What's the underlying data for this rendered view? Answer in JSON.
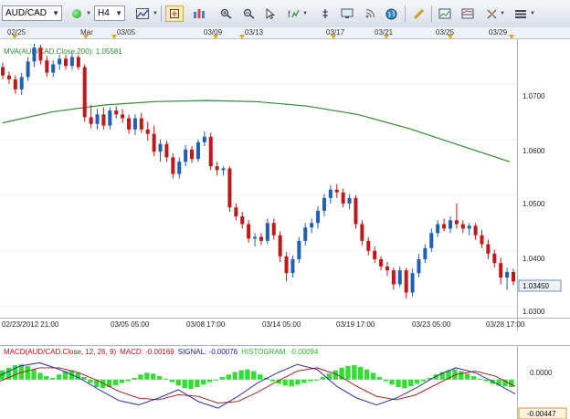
{
  "toolbar": {
    "symbol": "AUD/CAD",
    "timeframe": "H4",
    "icons": [
      "chart-type-icon",
      "crosshair-icon",
      "zoom-in-icon",
      "zoom-out-icon",
      "cursor-icon",
      "magnifier-icon",
      "indicators-icon",
      "properties-icon",
      "rss-icon",
      "globe-icon",
      "ruler-icon",
      "screenshot-icon",
      "template-icon",
      "drawing-tools-icon",
      "menu-icon"
    ]
  },
  "timeline": {
    "labels": [
      "02/25",
      "Mar",
      "03/05",
      "03/09",
      "03/13",
      "03/17",
      "03/21",
      "03/25",
      "03/29"
    ]
  },
  "price_panel": {
    "indicator_label": "MVA(AUD/CAD.Close,200): 1.05581",
    "current_price": "1.03450",
    "y_labels": [
      "1.0700",
      "1.0600",
      "1.0500",
      "1.0400",
      "1.0300"
    ],
    "x_labels": [
      "02/23/2012 21:00",
      "03/05 05:00",
      "03/08 17:00",
      "03/14 05:00",
      "03/19 17:00",
      "03/23 05:00",
      "03/28 17:00"
    ]
  },
  "macd_panel": {
    "label_macd": "MACD(AUD/CAD.Close, 12, 26, 9)",
    "label_value": "MACD: -0.00169",
    "label_signal": "SIGNAL: -0.00076",
    "label_histogram": "HISTOGRAM: -0.00094",
    "y_labels": [
      "0.0000",
      "-0.00447"
    ]
  },
  "colors": {
    "up": "#1f5fb4",
    "down": "#c01818",
    "mva": "#2e8b2e",
    "hist": "#33dd33",
    "macd": "#1a1aa8",
    "signal": "#a01010"
  },
  "chart_data": [
    {
      "type": "candlestick",
      "title": "AUD/CAD H4",
      "ylim": [
        1.028,
        1.078
      ],
      "series": [
        {
          "name": "AUD/CAD",
          "values": [
            [
              1.073,
              1.0738,
              1.0708,
              1.0715
            ],
            [
              1.0715,
              1.0722,
              1.07,
              1.0708
            ],
            [
              1.0708,
              1.0715,
              1.0682,
              1.069
            ],
            [
              1.069,
              1.072,
              1.068,
              1.0712
            ],
            [
              1.0712,
              1.0748,
              1.0705,
              1.074
            ],
            [
              1.074,
              1.0772,
              1.073,
              1.0765
            ],
            [
              1.0765,
              1.077,
              1.0735,
              1.0742
            ],
            [
              1.0742,
              1.075,
              1.0712,
              1.072
            ],
            [
              1.072,
              1.0742,
              1.0712,
              1.0735
            ],
            [
              1.0735,
              1.0752,
              1.0725,
              1.0745
            ],
            [
              1.0745,
              1.0752,
              1.0725,
              1.0732
            ],
            [
              1.0732,
              1.0755,
              1.0725,
              1.0748
            ],
            [
              1.0748,
              1.0752,
              1.0725,
              1.073
            ],
            [
              1.073,
              1.0735,
              1.0632,
              1.064
            ],
            [
              1.064,
              1.0662,
              1.062,
              1.0628
            ],
            [
              1.0628,
              1.0655,
              1.0618,
              1.0645
            ],
            [
              1.0645,
              1.0658,
              1.0618,
              1.0625
            ],
            [
              1.0625,
              1.0658,
              1.0618,
              1.0652
            ],
            [
              1.0652,
              1.066,
              1.0638,
              1.0645
            ],
            [
              1.0645,
              1.0655,
              1.063,
              1.0638
            ],
            [
              1.0638,
              1.0645,
              1.061,
              1.0618
            ],
            [
              1.0618,
              1.0645,
              1.0608,
              1.0638
            ],
            [
              1.0638,
              1.0648,
              1.0612,
              1.0618
            ],
            [
              1.0618,
              1.0632,
              1.0598,
              1.061
            ],
            [
              1.061,
              1.0625,
              1.057,
              1.0578
            ],
            [
              1.0578,
              1.06,
              1.056,
              1.0592
            ],
            [
              1.0592,
              1.0598,
              1.056,
              1.0568
            ],
            [
              1.0568,
              1.0575,
              1.053,
              1.0538
            ],
            [
              1.0538,
              1.0568,
              1.053,
              1.056
            ],
            [
              1.056,
              1.059,
              1.0552,
              1.0582
            ],
            [
              1.0582,
              1.0588,
              1.0558,
              1.0565
            ],
            [
              1.0565,
              1.06,
              1.056,
              1.0595
            ],
            [
              1.0595,
              1.0615,
              1.0588,
              1.0605
            ],
            [
              1.0605,
              1.0612,
              1.0545,
              1.0552
            ],
            [
              1.0552,
              1.056,
              1.0535,
              1.0545
            ],
            [
              1.0545,
              1.0552,
              1.0535,
              1.0548
            ],
            [
              1.0548,
              1.0552,
              1.047,
              1.0478
            ],
            [
              1.0478,
              1.0485,
              1.0455,
              1.0462
            ],
            [
              1.0462,
              1.047,
              1.044,
              1.0448
            ],
            [
              1.0448,
              1.0455,
              1.0415,
              1.0422
            ],
            [
              1.0422,
              1.0432,
              1.0408,
              1.0425
            ],
            [
              1.0425,
              1.0432,
              1.041,
              1.0418
            ],
            [
              1.0418,
              1.0458,
              1.0412,
              1.045
            ],
            [
              1.045,
              1.0458,
              1.042,
              1.0428
            ],
            [
              1.0428,
              1.0435,
              1.038,
              1.039
            ],
            [
              1.039,
              1.0398,
              1.0345,
              1.036
            ],
            [
              1.036,
              1.0392,
              1.0352,
              1.0385
            ],
            [
              1.0385,
              1.0425,
              1.0378,
              1.0418
            ],
            [
              1.0418,
              1.045,
              1.041,
              1.0442
            ],
            [
              1.0442,
              1.0458,
              1.0432,
              1.045
            ],
            [
              1.045,
              1.048,
              1.044,
              1.0472
            ],
            [
              1.0472,
              1.0502,
              1.0462,
              1.0495
            ],
            [
              1.0495,
              1.0518,
              1.0485,
              1.051
            ],
            [
              1.051,
              1.052,
              1.0495,
              1.0505
            ],
            [
              1.0505,
              1.0512,
              1.0478,
              1.0485
            ],
            [
              1.0485,
              1.0502,
              1.0475,
              1.0495
            ],
            [
              1.0495,
              1.05,
              1.044,
              1.0448
            ],
            [
              1.0448,
              1.0455,
              1.041,
              1.0418
            ],
            [
              1.0418,
              1.0425,
              1.0392,
              1.04
            ],
            [
              1.04,
              1.0408,
              1.0378,
              1.0385
            ],
            [
              1.0385,
              1.039,
              1.0365,
              1.0372
            ],
            [
              1.0372,
              1.038,
              1.0355,
              1.0365
            ],
            [
              1.0365,
              1.037,
              1.033,
              1.034
            ],
            [
              1.034,
              1.0372,
              1.0335,
              1.0365
            ],
            [
              1.0365,
              1.037,
              1.0315,
              1.0325
            ],
            [
              1.0325,
              1.0368,
              1.0318,
              1.036
            ],
            [
              1.036,
              1.0395,
              1.0352,
              1.0385
            ],
            [
              1.0385,
              1.0412,
              1.0378,
              1.0405
            ],
            [
              1.0405,
              1.044,
              1.0398,
              1.0432
            ],
            [
              1.0432,
              1.0455,
              1.0425,
              1.0448
            ],
            [
              1.0448,
              1.0458,
              1.0435,
              1.044
            ],
            [
              1.044,
              1.0462,
              1.0432,
              1.0455
            ],
            [
              1.0455,
              1.0485,
              1.044,
              1.0448
            ],
            [
              1.0448,
              1.0455,
              1.0432,
              1.044
            ],
            [
              1.044,
              1.045,
              1.0428,
              1.0445
            ],
            [
              1.0445,
              1.045,
              1.042,
              1.0428
            ],
            [
              1.0428,
              1.0438,
              1.0405,
              1.0412
            ],
            [
              1.0412,
              1.042,
              1.0385,
              1.0395
            ],
            [
              1.0395,
              1.0402,
              1.037,
              1.0378
            ],
            [
              1.0378,
              1.0388,
              1.034,
              1.0352
            ],
            [
              1.0352,
              1.037,
              1.033,
              1.0362
            ],
            [
              1.0362,
              1.0368,
              1.0338,
              1.0345
            ]
          ]
        },
        {
          "name": "MVA(200)",
          "values": [
            1.063,
            1.065,
            1.0662,
            1.0668,
            1.067,
            1.0668,
            1.066,
            1.0645,
            1.062,
            1.059,
            1.056
          ]
        }
      ]
    },
    {
      "type": "line",
      "title": "MACD(AUD/CAD.Close, 12, 26, 9)",
      "ylim": [
        -0.00447,
        0.0028
      ],
      "series": [
        {
          "name": "HISTOGRAM",
          "values": [
            0.0011,
            0.0014,
            0.0017,
            0.0018,
            0.0016,
            0.0012,
            0.0008,
            0.0004,
            0.0002,
            0.0006,
            0.001,
            0.0011,
            0.0008,
            0.0003,
            -0.0004,
            -0.0009,
            -0.001,
            -0.0009,
            -0.0007,
            -0.0004,
            -0.0002,
            0.0002,
            0.0006,
            0.0008,
            0.0007,
            0.0004,
            0.0001,
            -0.0003,
            -0.0007,
            -0.001,
            -0.0011,
            -0.0009,
            -0.0006,
            -0.0003,
            0.0,
            0.0003,
            0.0006,
            0.0009,
            0.0011,
            0.0012,
            0.001,
            0.0006,
            0.0002,
            -0.0002,
            -0.0005,
            -0.0007,
            -0.0008,
            -0.0006,
            -0.0004,
            -0.0002,
            0.0,
            0.0003,
            0.0007,
            0.0011,
            0.0014,
            0.0016,
            0.0017,
            0.0015,
            0.0012,
            0.0008,
            0.0003,
            -0.0002,
            -0.0006,
            -0.0009,
            -0.001,
            -0.0008,
            -0.0005,
            -0.0002,
            0.0002,
            0.0006,
            0.0009,
            0.0011,
            0.0012,
            0.001,
            0.0007,
            0.0004,
            0.0001,
            -0.0002,
            -0.0005,
            -0.0007,
            -0.0008,
            -0.0009
          ]
        },
        {
          "name": "MACD",
          "values": [
            0.0005,
            0.0016,
            0.002,
            0.0012,
            0.0002,
            -0.0012,
            -0.0025,
            -0.003,
            -0.0022,
            -0.0012,
            -0.0026,
            -0.0034,
            -0.002,
            -0.0004,
            0.0008,
            0.0018,
            0.0012,
            -0.0008,
            -0.0022,
            -0.003,
            -0.0022,
            -0.001,
            0.0004,
            0.0014,
            0.0008,
            -0.0004,
            -0.0017
          ]
        },
        {
          "name": "SIGNAL",
          "values": [
            -0.0002,
            0.0008,
            0.0014,
            0.0014,
            0.0008,
            -0.0002,
            -0.0014,
            -0.0022,
            -0.0024,
            -0.0018,
            -0.002,
            -0.0028,
            -0.0026,
            -0.0015,
            -0.0002,
            0.001,
            0.0014,
            0.0006,
            -0.0008,
            -0.002,
            -0.0024,
            -0.0018,
            -0.0006,
            0.0006,
            0.001,
            0.0004,
            -0.0008
          ]
        }
      ]
    }
  ]
}
